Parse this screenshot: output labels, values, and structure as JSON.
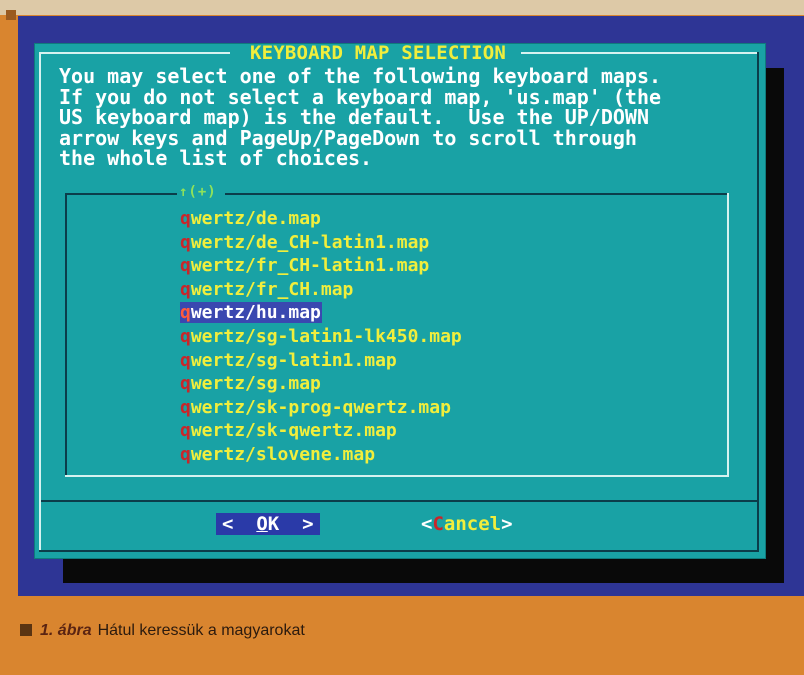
{
  "dialog": {
    "title": "KEYBOARD MAP SELECTION",
    "description": [
      "You may select one of the following keyboard maps.",
      "If you do not select a keyboard map, 'us.map' (the",
      "US keyboard map) is the default.  Use the UP/DOWN",
      "arrow keys and PageUp/PageDown to scroll through",
      "the whole list of choices."
    ],
    "scroll_indicator": "↑(+)",
    "items": [
      {
        "hotkey": "q",
        "rest": "wertz/de.map"
      },
      {
        "hotkey": "q",
        "rest": "wertz/de_CH-latin1.map"
      },
      {
        "hotkey": "q",
        "rest": "wertz/fr_CH-latin1.map"
      },
      {
        "hotkey": "q",
        "rest": "wertz/fr_CH.map"
      },
      {
        "hotkey": "q",
        "rest": "wertz/hu.map"
      },
      {
        "hotkey": "q",
        "rest": "wertz/sg-latin1-lk450.map"
      },
      {
        "hotkey": "q",
        "rest": "wertz/sg-latin1.map"
      },
      {
        "hotkey": "q",
        "rest": "wertz/sg.map"
      },
      {
        "hotkey": "q",
        "rest": "wertz/sk-prog-qwertz.map"
      },
      {
        "hotkey": "q",
        "rest": "wertz/sk-qwertz.map"
      },
      {
        "hotkey": "q",
        "rest": "wertz/slovene.map"
      }
    ],
    "selected_item": "qwertz/hu.map",
    "ok_button": {
      "left": "<  ",
      "hot": "O",
      "rest": "K",
      "right": "  >"
    },
    "cancel_button": {
      "left": "<",
      "hot": "C",
      "rest": "ancel",
      "right": ">"
    }
  },
  "caption": {
    "label": "1. ábra",
    "text": "Hátul keressük a magyarokat"
  },
  "colors": {
    "page_background": "#d9852f",
    "screen_background": "#2e3595",
    "dialog_background": "#19a2a5",
    "title_text": "#f1ee3c",
    "hotkey_text": "#c9262a",
    "selection_background": "#3a48b0"
  }
}
